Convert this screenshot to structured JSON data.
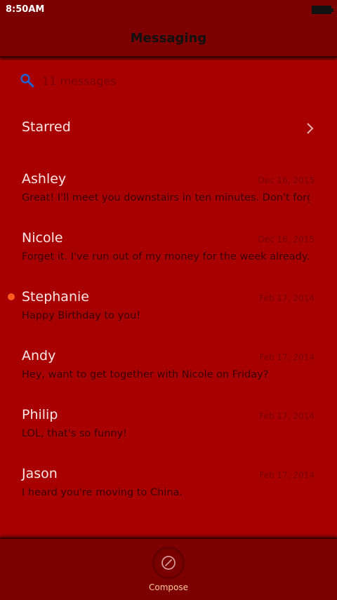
{
  "status_bar": {
    "time": "8:50AM"
  },
  "header": {
    "title": "Messaging"
  },
  "search": {
    "count_text": "11 messages"
  },
  "starred": {
    "label": "Starred"
  },
  "messages": [
    {
      "name": "Ashley",
      "date": "Dec 16, 2015",
      "preview": "Great! I'll meet you downstairs in ten minutes. Don't forge",
      "unread": false
    },
    {
      "name": "Nicole",
      "date": "Dec 16, 2015",
      "preview": "Forget it. I've run out of my money for the week already.",
      "unread": false
    },
    {
      "name": "Stephanie",
      "date": "Feb 17, 2014",
      "preview": "Happy Birthday to you!",
      "unread": true
    },
    {
      "name": "Andy",
      "date": "Feb 17, 2014",
      "preview": "Hey, want to get together with Nicole on Friday?",
      "unread": false
    },
    {
      "name": "Philip",
      "date": "Feb 17, 2014",
      "preview": "LOL, that's so funny!",
      "unread": false
    },
    {
      "name": "Jason",
      "date": "Feb 17, 2014",
      "preview": "I heard you're moving to China.",
      "unread": false
    }
  ],
  "bottom": {
    "compose_label": "Compose"
  },
  "colors": {
    "background": "#a80000",
    "bars": "#7c0000",
    "unread_dot": "#ff5a1f",
    "search_icon": "#1e63d6",
    "compose_label": "#ffcc99"
  },
  "icons": {
    "search": "search-icon",
    "chevron": "chevron-right-icon",
    "compose": "compose-icon",
    "battery": "battery-icon",
    "unread": "unread-dot-icon"
  }
}
